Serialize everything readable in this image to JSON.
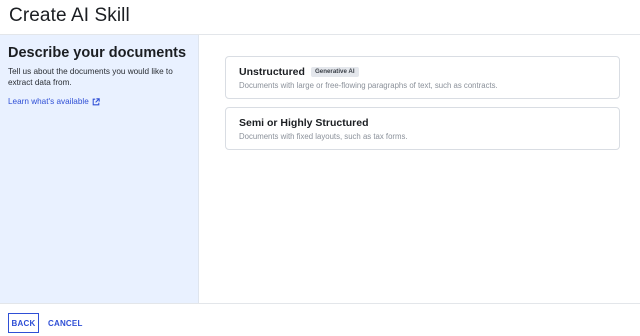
{
  "header": {
    "title": "Create AI Skill"
  },
  "sidebar": {
    "heading": "Describe your documents",
    "description": "Tell us about the documents you would like to extract data from.",
    "link_label": "Learn what's available",
    "link_icon": "external-link-icon"
  },
  "options": [
    {
      "title": "Unstructured",
      "badge": "Generative AI",
      "description": "Documents with large or free-flowing paragraphs of text, such as contracts."
    },
    {
      "title": "Semi or Highly Structured",
      "description": "Documents with fixed layouts, such as tax forms."
    }
  ],
  "footer": {
    "back_label": "BACK",
    "cancel_label": "CANCEL"
  },
  "colors": {
    "accent": "#2f4fd6",
    "sidebar_bg": "#e9f1ff",
    "badge_bg": "#e4e7ec"
  }
}
